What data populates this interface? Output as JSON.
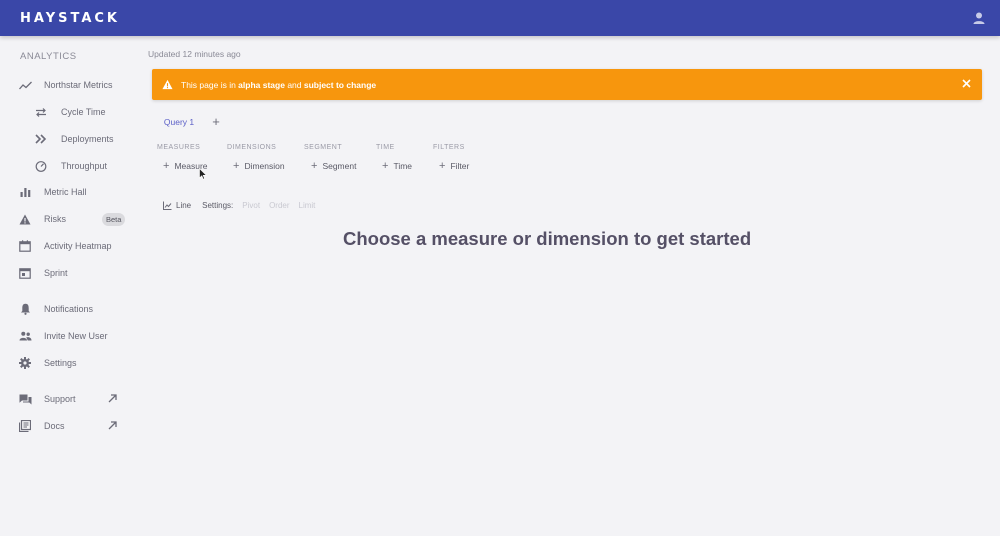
{
  "app": {
    "logo": "HAYSTACK"
  },
  "sidebar": {
    "heading": "ANALYTICS",
    "items": [
      {
        "label": "Northstar Metrics",
        "icon": "trending-icon"
      },
      {
        "label": "Cycle Time",
        "icon": "cycle-icon"
      },
      {
        "label": "Deployments",
        "icon": "double-chevron-icon"
      },
      {
        "label": "Throughput",
        "icon": "speedometer-icon"
      },
      {
        "label": "Metric Hall",
        "icon": "bar-chart-icon"
      },
      {
        "label": "Risks",
        "icon": "warning-icon",
        "badge": "Beta"
      },
      {
        "label": "Activity Heatmap",
        "icon": "calendar-icon"
      },
      {
        "label": "Sprint",
        "icon": "calendar-day-icon"
      },
      {
        "label": "Notifications",
        "icon": "bell-icon"
      },
      {
        "label": "Invite New User",
        "icon": "people-icon"
      },
      {
        "label": "Settings",
        "icon": "gear-icon"
      },
      {
        "label": "Support",
        "icon": "chat-icon"
      },
      {
        "label": "Docs",
        "icon": "library-icon"
      }
    ]
  },
  "main": {
    "updated": "Updated 12 minutes ago",
    "alert": {
      "prefix": "This page is in ",
      "stage": "alpha stage",
      "middle": " and ",
      "change": "subject to change"
    },
    "tabs": [
      {
        "label": "Query 1"
      }
    ],
    "categories": [
      {
        "label": "MEASURES",
        "button": "Measure"
      },
      {
        "label": "DIMENSIONS",
        "button": "Dimension"
      },
      {
        "label": "SEGMENT",
        "button": "Segment"
      },
      {
        "label": "TIME",
        "button": "Time"
      },
      {
        "label": "FILTERS",
        "button": "Filter"
      }
    ],
    "chart_type": "Line",
    "settings_label": "Settings:",
    "settings_options": [
      "Pivot",
      "Order",
      "Limit"
    ],
    "empty_message": "Choose a measure or dimension to get started"
  },
  "colors": {
    "topbar": "#3a47a8",
    "alert": "#f7960d",
    "accent": "#5b5fc7",
    "background": "#f3f3f6"
  }
}
